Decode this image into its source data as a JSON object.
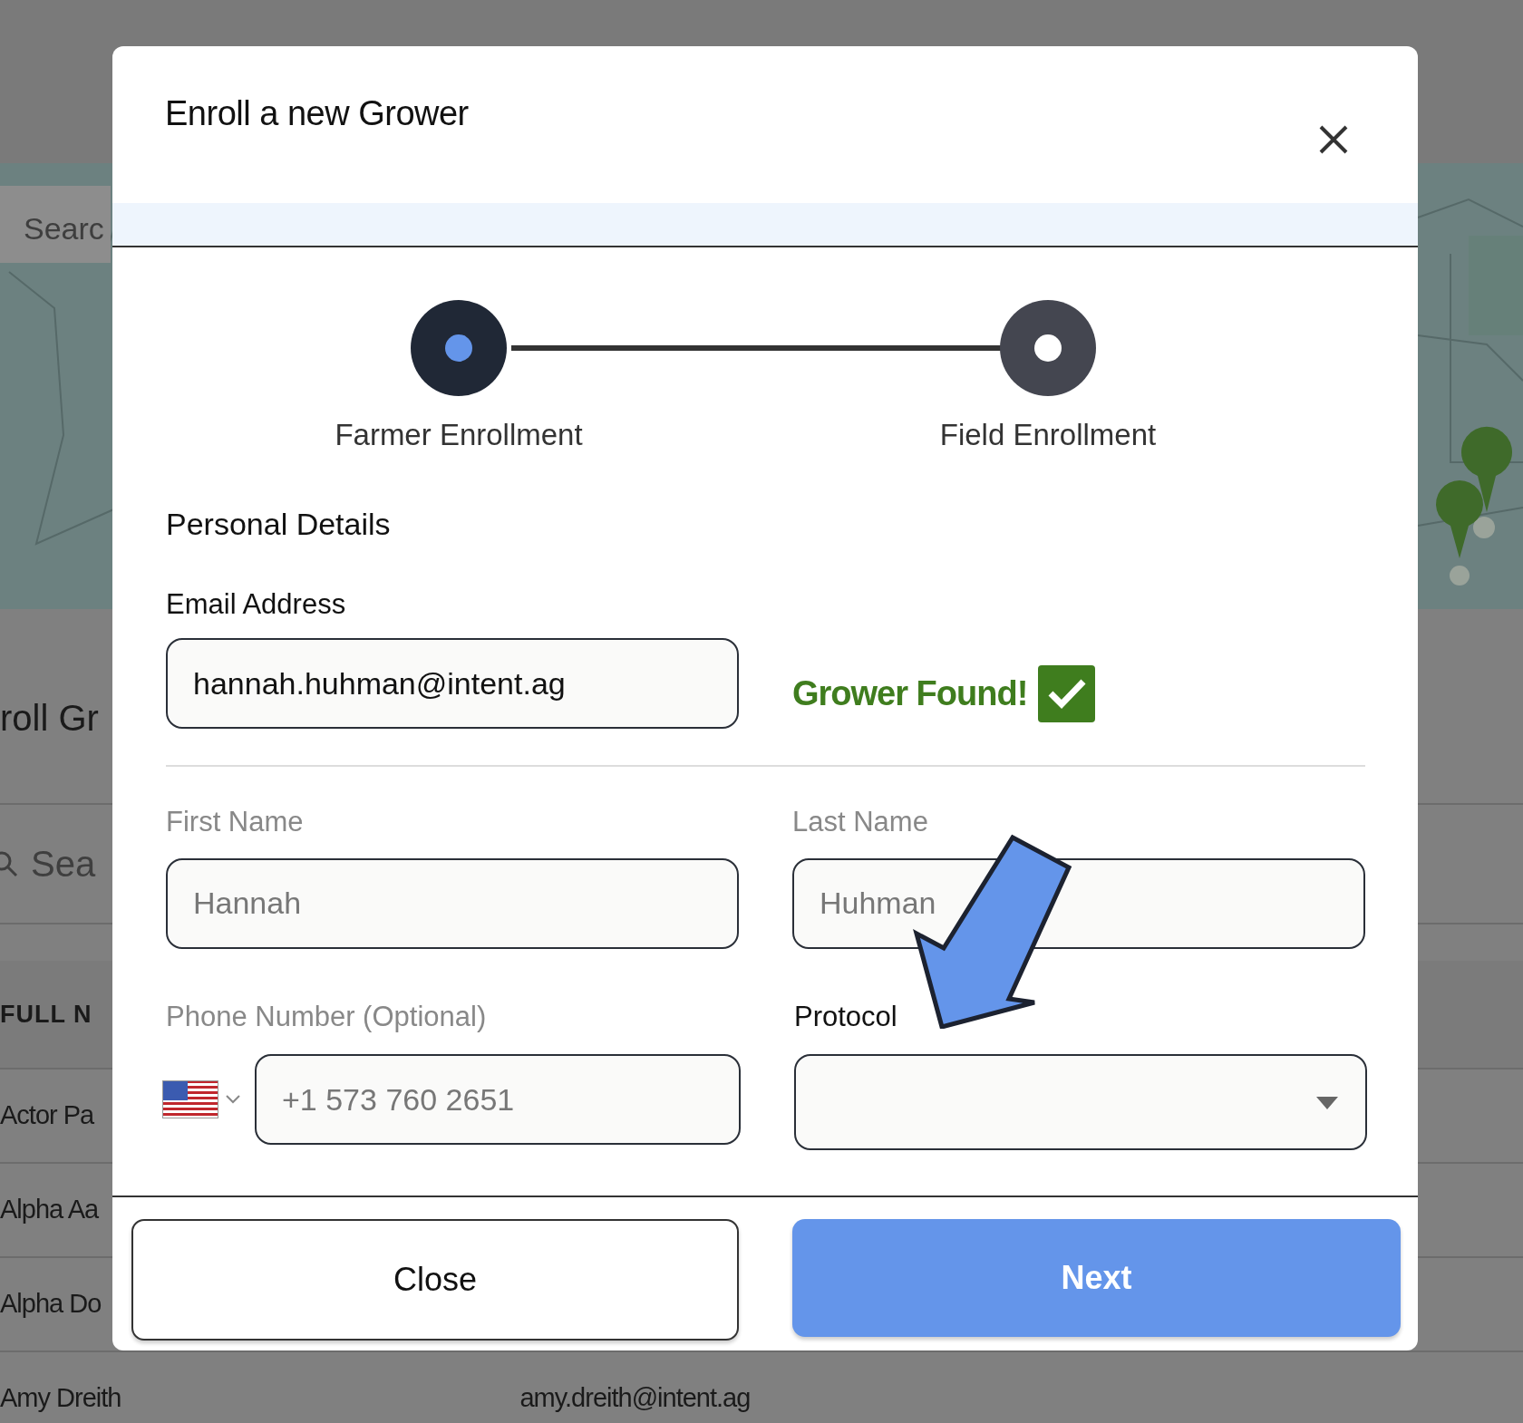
{
  "background": {
    "search_placeholder": "Searc",
    "heading": "roll Gr",
    "table_search_placeholder": "Sea",
    "column_header": "FULL N",
    "rows": [
      {
        "name": "Actor Pa"
      },
      {
        "name": "Alpha Aa"
      },
      {
        "name": "Alpha Do"
      },
      {
        "name": "Amy Dreith",
        "email": "amy.dreith@intent.ag"
      }
    ]
  },
  "modal": {
    "title": "Enroll a new Grower",
    "steps": [
      {
        "label": "Farmer Enrollment",
        "selected": true
      },
      {
        "label": "Field Enrollment",
        "selected": false
      }
    ],
    "section_title": "Personal Details",
    "email": {
      "label": "Email Address",
      "value": "hannah.huhman@intent.ag"
    },
    "status": {
      "text": "Grower Found!",
      "checked": true
    },
    "first_name": {
      "label": "First Name",
      "value": "Hannah",
      "disabled": true
    },
    "last_name": {
      "label": "Last Name",
      "value": "Huhman",
      "disabled": true
    },
    "phone": {
      "label": "Phone Number (Optional)",
      "value": "+1 573 760 2651",
      "disabled": true
    },
    "protocol": {
      "label": "Protocol"
    },
    "buttons": [
      {
        "label": "Close",
        "kind": "secondary"
      },
      {
        "label": "Next",
        "kind": "primary"
      }
    ]
  }
}
